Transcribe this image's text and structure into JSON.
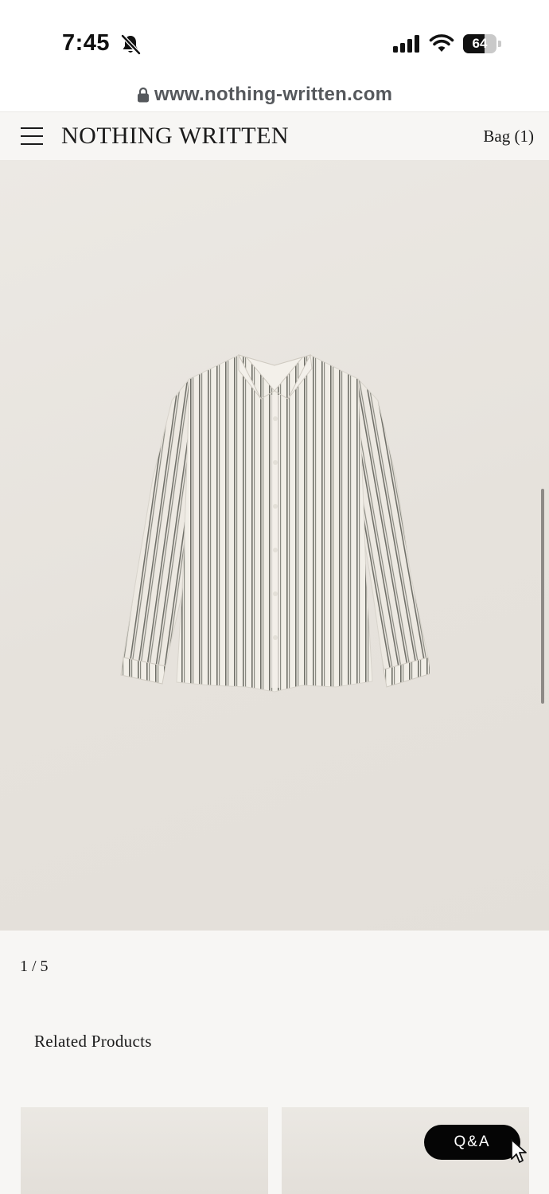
{
  "status_bar": {
    "time": "7:45",
    "battery_level": "64",
    "battery_fraction": 0.64,
    "icons": [
      "bell-slash-icon",
      "cellular-signal-icon",
      "wifi-icon",
      "battery-icon"
    ]
  },
  "browser": {
    "url": "www.nothing-written.com",
    "lock_icon": "lock-icon"
  },
  "header": {
    "brand": "NOTHING WRITTEN",
    "bag_label": "Bag (1)",
    "menu_icon": "hamburger-menu-icon"
  },
  "product": {
    "image_subject": "striped-shirt",
    "image_counter": "1 / 5"
  },
  "related": {
    "title": "Related Products",
    "items": [
      {
        "image": "related-product-image"
      },
      {
        "image": "related-product-image"
      }
    ]
  },
  "qa_button": {
    "label": "Q&A"
  },
  "colors": {
    "page_background": "#f7f6f4",
    "image_background": "#e8e5e0",
    "text": "#1a1a1a",
    "qa_button": "#050505",
    "url_text": "#55585c"
  }
}
